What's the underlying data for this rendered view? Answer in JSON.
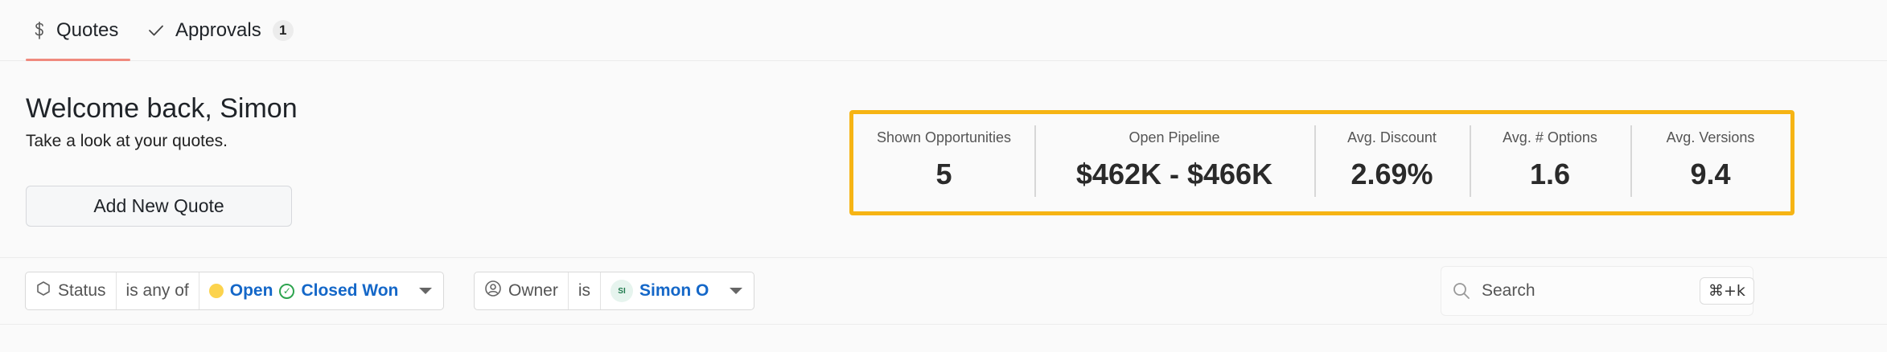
{
  "tabs": [
    {
      "label": "Quotes",
      "icon": "dollar-icon",
      "active": true
    },
    {
      "label": "Approvals",
      "icon": "check-icon",
      "badge": "1"
    }
  ],
  "welcome": {
    "title": "Welcome back, Simon",
    "subtitle": "Take a look at your quotes.",
    "add_button": "Add New Quote"
  },
  "stats": [
    {
      "label": "Shown Opportunities",
      "value": "5"
    },
    {
      "label": "Open Pipeline",
      "value": "$462K - $466K"
    },
    {
      "label": "Avg. Discount",
      "value": "2.69%"
    },
    {
      "label": "Avg. # Options",
      "value": "1.6"
    },
    {
      "label": "Avg. Versions",
      "value": "9.4"
    }
  ],
  "filters": {
    "status": {
      "field": "Status",
      "operator": "is any of",
      "values": [
        "Open",
        "Closed Won"
      ]
    },
    "owner": {
      "field": "Owner",
      "operator": "is",
      "avatar": "SI",
      "value": "Simon O"
    }
  },
  "search": {
    "placeholder": "Search",
    "shortcut": "⌘+k"
  },
  "colors": {
    "accent_tab": "#f08a7e",
    "highlight_border": "#f6b414",
    "link_blue": "#1467c8"
  }
}
